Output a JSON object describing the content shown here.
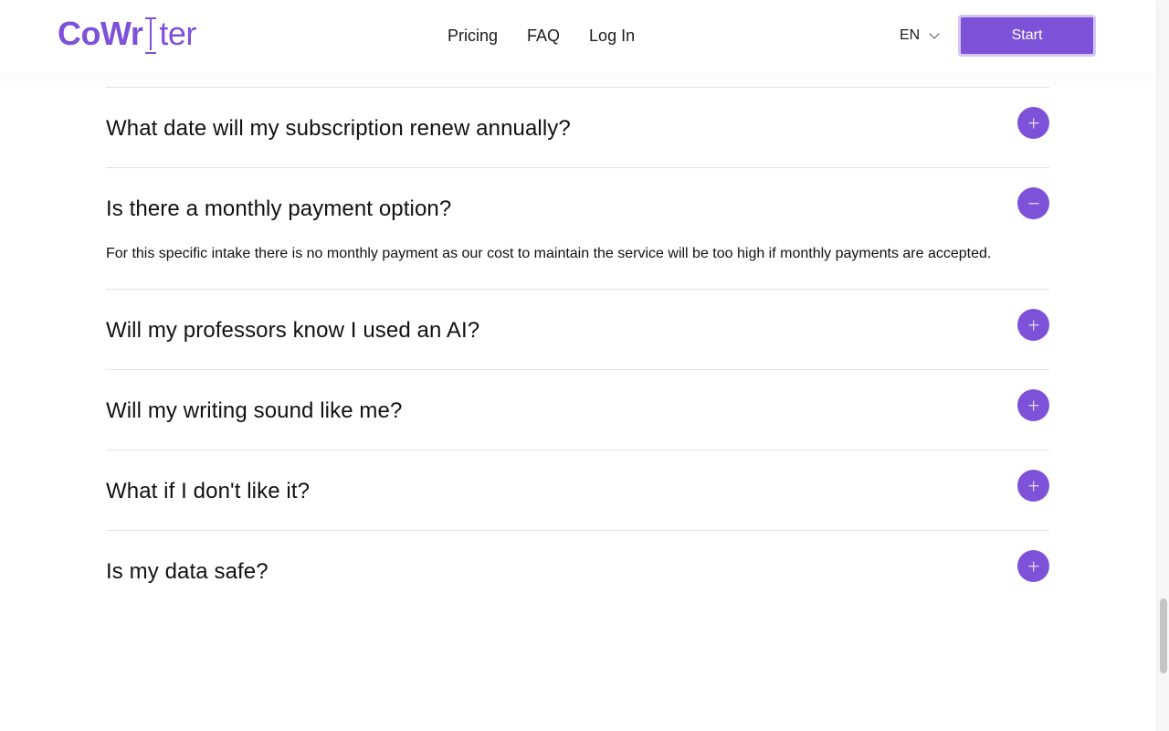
{
  "header": {
    "logo": {
      "part1": "CoWr",
      "part2": "ter"
    },
    "nav": [
      {
        "label": "Pricing"
      },
      {
        "label": "FAQ"
      },
      {
        "label": "Log In"
      }
    ],
    "language": "EN",
    "start_label": "Start"
  },
  "faq": {
    "items": [
      {
        "question": "What date will my subscription renew annually?",
        "expanded": false
      },
      {
        "question": "Is there a monthly payment option?",
        "expanded": true,
        "answer": "For this specific intake there is no monthly payment as our cost to maintain the service will be too high if monthly payments are accepted."
      },
      {
        "question": "Will my professors know I used an AI?",
        "expanded": false
      },
      {
        "question": "Will my writing sound like me?",
        "expanded": false
      },
      {
        "question": "What if I don't like it?",
        "expanded": false
      },
      {
        "question": "Is my data safe?",
        "expanded": false
      }
    ]
  },
  "colors": {
    "accent": "#7e52d8",
    "divider": "#e2e2e2"
  },
  "icons": {
    "expand": "plus-icon",
    "collapse": "minus-icon",
    "language_dropdown": "chevron-down-icon"
  }
}
